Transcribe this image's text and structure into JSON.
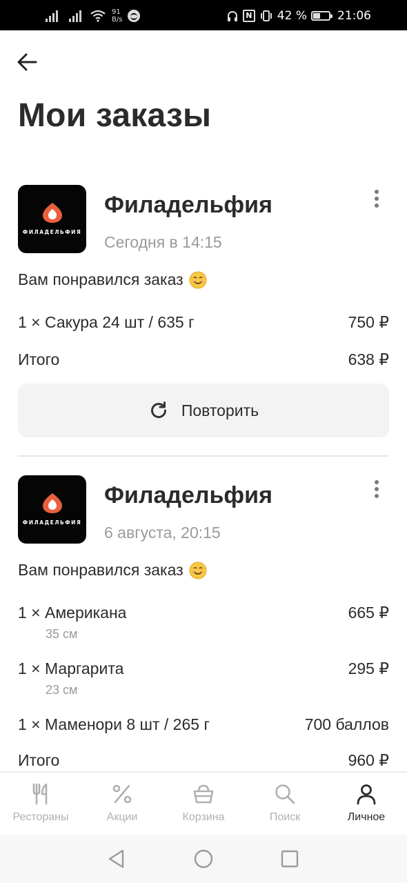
{
  "status_bar": {
    "net_speed_value": "91",
    "net_speed_unit": "B/s",
    "battery_percent": "42 %",
    "time": "21:06",
    "battery_level": 0.42
  },
  "header": {
    "title": "Мои заказы"
  },
  "orders": [
    {
      "restaurant": "Филадельфия",
      "logo_text": "ФИЛАДЕЛЬФИЯ",
      "date": "Сегодня в 14:15",
      "feedback": "Вам понравился заказ",
      "items": [
        {
          "name": "1 × Сакура 24 шт / 635 г",
          "price": "750 ₽"
        }
      ],
      "total_label": "Итого",
      "total": "638 ₽",
      "repeat_label": "Повторить"
    },
    {
      "restaurant": "Филадельфия",
      "logo_text": "ФИЛАДЕЛЬФИЯ",
      "date": "6 августа, 20:15",
      "feedback": "Вам понравился заказ",
      "items": [
        {
          "name": "1 × Американа",
          "sub": "35 см",
          "price": "665 ₽"
        },
        {
          "name": "1 × Маргарита",
          "sub": "23 см",
          "price": "295 ₽"
        },
        {
          "name": "1 × Маменори 8 шт / 265 г",
          "price": "700 баллов"
        }
      ],
      "total_label": "Итого",
      "total": "960 ₽"
    }
  ],
  "bottom_nav": {
    "items": [
      {
        "label": "Рестораны",
        "icon": "fork-knife-icon"
      },
      {
        "label": "Акции",
        "icon": "percent-icon"
      },
      {
        "label": "Корзина",
        "icon": "basket-icon"
      },
      {
        "label": "Поиск",
        "icon": "search-icon"
      },
      {
        "label": "Личное",
        "icon": "person-icon",
        "active": true
      }
    ]
  },
  "colors": {
    "accent_logo": "#e8603c",
    "text_primary": "#2b2b2b",
    "text_secondary": "#9a9a9a",
    "nav_inactive": "#b0b0b0"
  }
}
